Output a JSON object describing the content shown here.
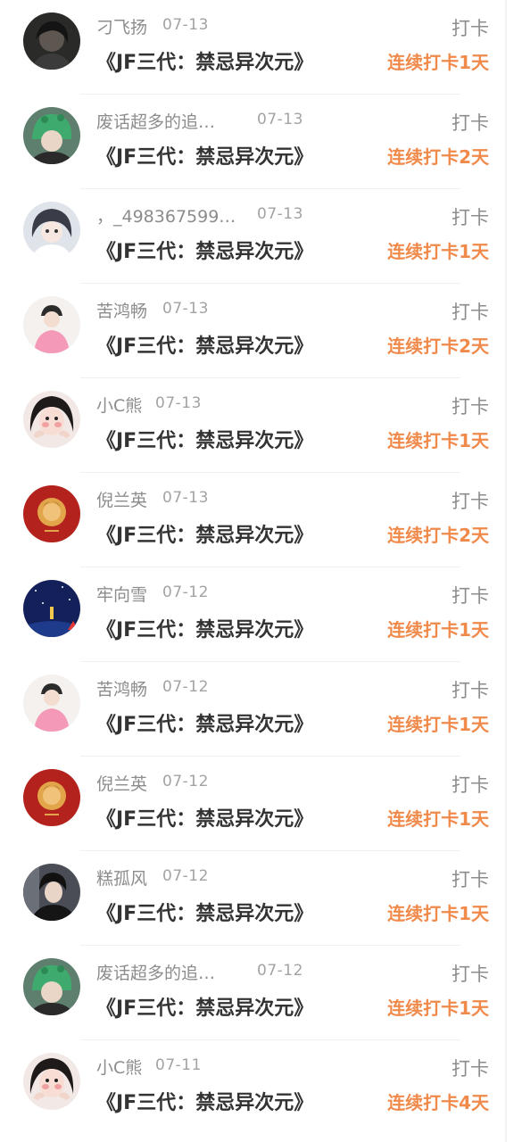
{
  "checkin_label": "打卡",
  "accent_color": "#f08a4b",
  "entries": [
    {
      "username": "刁飞扬",
      "date": "07-13",
      "title": "《JF三代：禁忌异次元》",
      "streak": "连续打卡1天",
      "avatar": "avatar-dark-hair"
    },
    {
      "username": "废话超多的追…",
      "date": "07-13",
      "title": "《JF三代：禁忌异次元》",
      "streak": "连续打卡2天",
      "avatar": "avatar-green-hat"
    },
    {
      "username": "，_498367599…",
      "date": "07-13",
      "title": "《JF三代：禁忌异次元》",
      "streak": "连续打卡1天",
      "avatar": "avatar-anime-girl"
    },
    {
      "username": "苦鸿畅",
      "date": "07-13",
      "title": "《JF三代：禁忌异次元》",
      "streak": "连续打卡2天",
      "avatar": "avatar-pink-jacket"
    },
    {
      "username": "小C熊",
      "date": "07-13",
      "title": "《JF三代：禁忌异次元》",
      "streak": "连续打卡1天",
      "avatar": "avatar-girl-hands"
    },
    {
      "username": "倪兰英",
      "date": "07-13",
      "title": "《JF三代：禁忌异次元》",
      "streak": "连续打卡2天",
      "avatar": "avatar-red-album"
    },
    {
      "username": "牢向雪",
      "date": "07-12",
      "title": "《JF三代：禁忌异次元》",
      "streak": "连续打卡1天",
      "avatar": "avatar-night-sky"
    },
    {
      "username": "苦鸿畅",
      "date": "07-12",
      "title": "《JF三代：禁忌异次元》",
      "streak": "连续打卡1天",
      "avatar": "avatar-pink-jacket"
    },
    {
      "username": "倪兰英",
      "date": "07-12",
      "title": "《JF三代：禁忌异次元》",
      "streak": "连续打卡1天",
      "avatar": "avatar-red-album"
    },
    {
      "username": "糕孤风",
      "date": "07-12",
      "title": "《JF三代：禁忌异次元》",
      "streak": "连续打卡1天",
      "avatar": "avatar-boy-dark"
    },
    {
      "username": "废话超多的追…",
      "date": "07-12",
      "title": "《JF三代：禁忌异次元》",
      "streak": "连续打卡1天",
      "avatar": "avatar-green-hat"
    },
    {
      "username": "小C熊",
      "date": "07-11",
      "title": "《JF三代：禁忌异次元》",
      "streak": "连续打卡4天",
      "avatar": "avatar-girl-hands"
    }
  ]
}
